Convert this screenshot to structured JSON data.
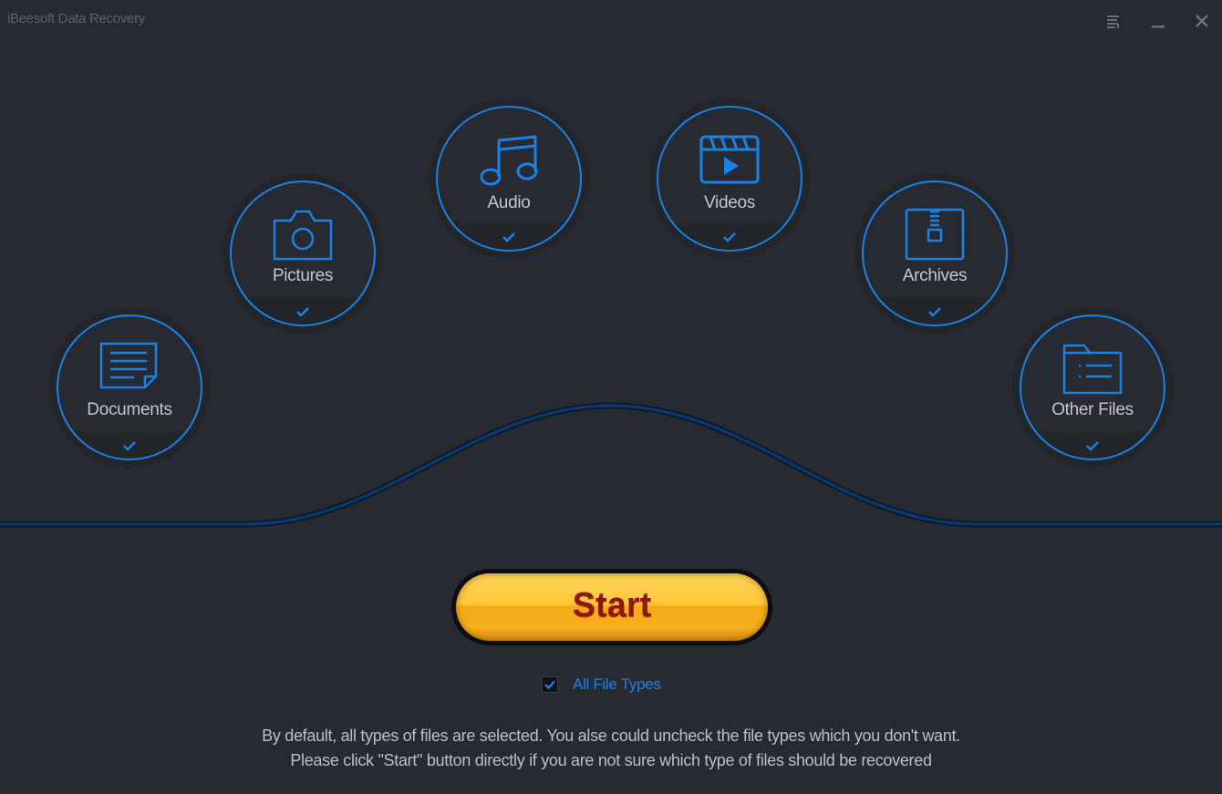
{
  "window": {
    "title": "iBeesoft Data Recovery",
    "controls": [
      {
        "name": "menu-icon",
        "label": "Menu"
      },
      {
        "name": "minimize-icon",
        "label": "Minimize"
      },
      {
        "name": "close-icon",
        "label": "Close"
      }
    ]
  },
  "categories": [
    {
      "id": "documents",
      "label": "Documents",
      "icon": "document-icon",
      "checked": true
    },
    {
      "id": "pictures",
      "label": "Pictures",
      "icon": "camera-icon",
      "checked": true
    },
    {
      "id": "audio",
      "label": "Audio",
      "icon": "music-note-icon",
      "checked": true
    },
    {
      "id": "videos",
      "label": "Videos",
      "icon": "video-clapper-icon",
      "checked": true
    },
    {
      "id": "archives",
      "label": "Archives",
      "icon": "zip-archive-icon",
      "checked": true
    },
    {
      "id": "other",
      "label": "Other Files",
      "icon": "folder-list-icon",
      "checked": true
    }
  ],
  "start_button": {
    "label": "Start"
  },
  "all_file_types": {
    "label": "All File Types",
    "checked": true
  },
  "description": {
    "line1": "By default, all types of files are selected. You alse could uncheck the file types which you don't want.",
    "line2": "Please click \"Start\" button directly if you are not sure which type of files should be recovered"
  },
  "colors": {
    "accent": "#1a82e6",
    "background": "#272a30",
    "start_button": "#ffc83a",
    "start_text": "#8a1a06"
  }
}
